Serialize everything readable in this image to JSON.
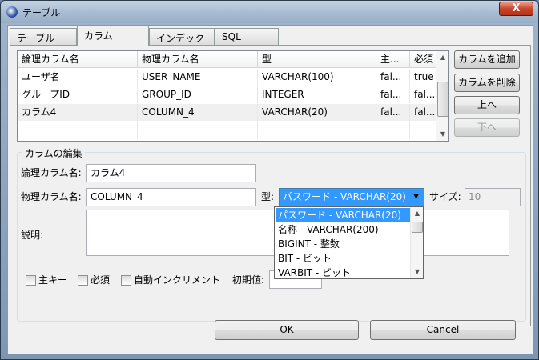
{
  "window": {
    "title": "テーブル",
    "close": "X"
  },
  "tabs": [
    "テーブル",
    "カラム",
    "インデックス",
    "SQL"
  ],
  "columns_table": {
    "headers": [
      "論理カラム名",
      "物理カラム名",
      "型",
      "主...",
      "必須"
    ],
    "rows": [
      [
        "ユーザ名",
        "USER_NAME",
        "VARCHAR(100)",
        "fal...",
        "true"
      ],
      [
        "グループID",
        "GROUP_ID",
        "INTEGER",
        "fal...",
        "fal..."
      ],
      [
        "カラム4",
        "COLUMN_4",
        "VARCHAR(20)",
        "fal...",
        "fal..."
      ]
    ]
  },
  "side_buttons": {
    "add": "カラムを追加",
    "delete": "カラムを削除",
    "up": "上へ",
    "down": "下へ"
  },
  "edit": {
    "group_label": "カラムの編集",
    "logical_label": "論理カラム名:",
    "logical_value": "カラム4",
    "physical_label": "物理カラム名:",
    "physical_value": "COLUMN_4",
    "type_label": "型:",
    "type_value": "パスワード - VARCHAR(20)",
    "size_label": "サイズ:",
    "size_value": "10",
    "desc_label": "説明:",
    "checks": {
      "pk": "主キー",
      "required": "必須",
      "autoinc": "自動インクリメント"
    },
    "default_label": "初期値:"
  },
  "type_options": [
    "パスワード - VARCHAR(20)",
    "名称 - VARCHAR(200)",
    "BIGINT - 整数",
    "BIT - ビット",
    "VARBIT - ビット"
  ],
  "footer": {
    "ok": "OK",
    "cancel": "Cancel"
  }
}
